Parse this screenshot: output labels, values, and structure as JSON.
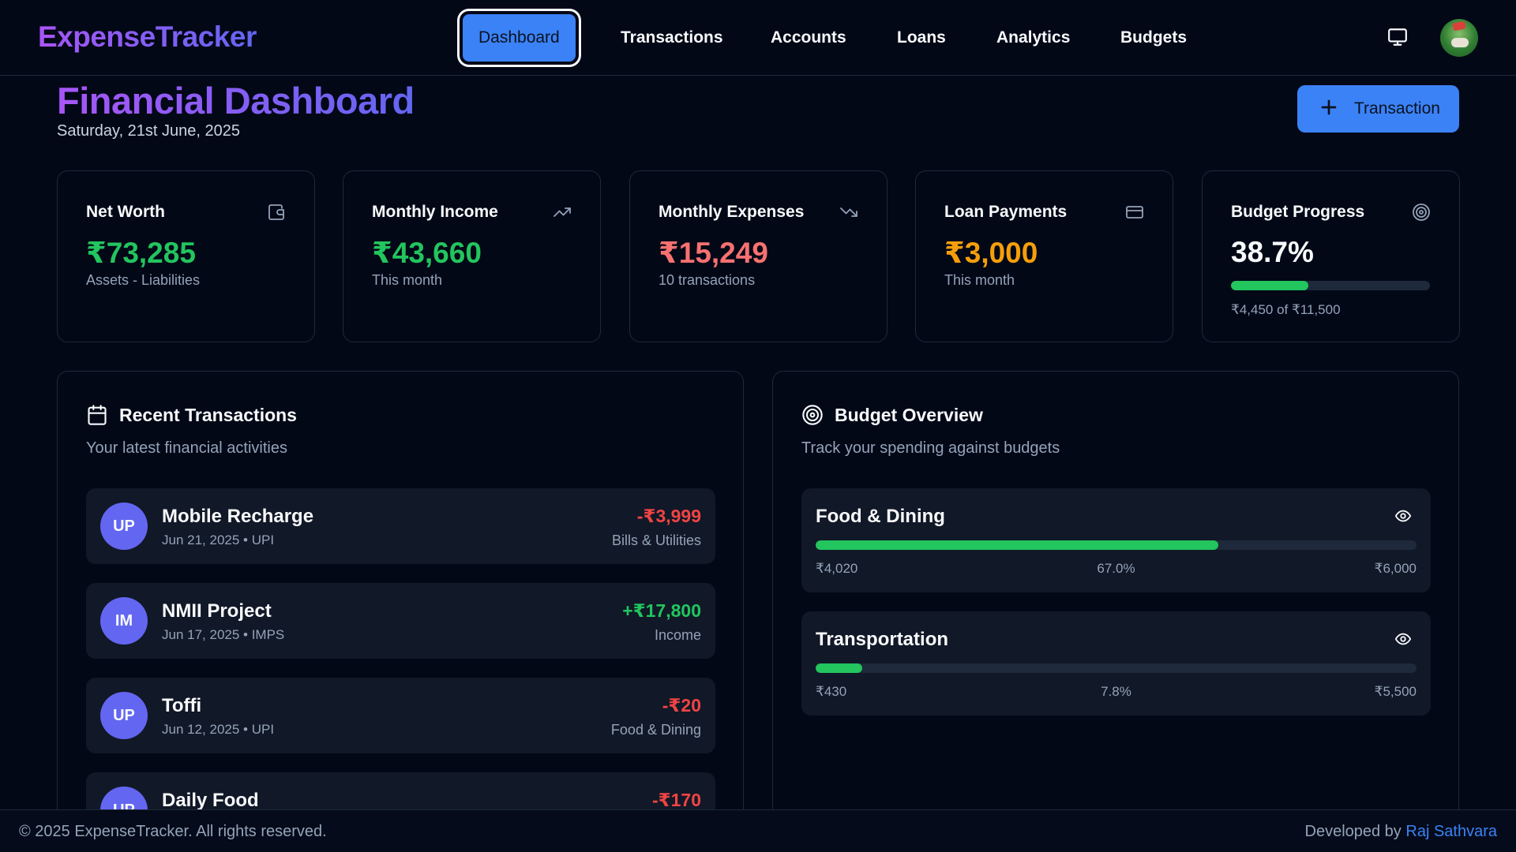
{
  "app": {
    "brand": "ExpenseTracker"
  },
  "nav": {
    "items": [
      "Dashboard",
      "Transactions",
      "Accounts",
      "Loans",
      "Analytics",
      "Budgets"
    ],
    "active": "Dashboard"
  },
  "header": {
    "title": "Financial Dashboard",
    "date": "Saturday, 21st June, 2025",
    "add_button_label": "Transaction"
  },
  "stats": {
    "net_worth": {
      "title": "Net Worth",
      "value": "₹73,285",
      "sub": "Assets - Liabilities",
      "icon": "wallet-icon"
    },
    "monthly_income": {
      "title": "Monthly Income",
      "value": "₹43,660",
      "sub": "This month",
      "icon": "trending-up-icon"
    },
    "monthly_expenses": {
      "title": "Monthly Expenses",
      "value": "₹15,249",
      "sub": "10 transactions",
      "icon": "trending-down-icon"
    },
    "loan_payments": {
      "title": "Loan Payments",
      "value": "₹3,000",
      "sub": "This month",
      "icon": "credit-card-icon"
    },
    "budget_progress": {
      "title": "Budget Progress",
      "value": "38.7%",
      "progress": 0.387,
      "sub": "₹4,450 of ₹11,500",
      "icon": "target-icon"
    }
  },
  "recent_transactions": {
    "title": "Recent Transactions",
    "subtitle": "Your latest financial activities",
    "items": [
      {
        "badge": "UP",
        "name": "Mobile Recharge",
        "meta": "Jun 21, 2025 • UPI",
        "amount": "-₹3,999",
        "category": "Bills & Utilities",
        "type": "expense"
      },
      {
        "badge": "IM",
        "name": "NMII Project",
        "meta": "Jun 17, 2025 • IMPS",
        "amount": "+₹17,800",
        "category": "Income",
        "type": "income"
      },
      {
        "badge": "UP",
        "name": "Toffi",
        "meta": "Jun 12, 2025 • UPI",
        "amount": "-₹20",
        "category": "Food & Dining",
        "type": "expense"
      },
      {
        "badge": "UP",
        "name": "Daily Food",
        "meta": "",
        "amount": "-₹170",
        "category": "",
        "type": "expense"
      }
    ]
  },
  "budget_overview": {
    "title": "Budget Overview",
    "subtitle": "Track your spending against budgets",
    "items": [
      {
        "name": "Food & Dining",
        "spent": "₹4,020",
        "percent": "67.0%",
        "progress": 0.67,
        "limit": "₹6,000"
      },
      {
        "name": "Transportation",
        "spent": "₹430",
        "percent": "7.8%",
        "progress": 0.078,
        "limit": "₹5,500"
      }
    ]
  },
  "footer": {
    "copyright": "© 2025 ExpenseTracker. All rights reserved.",
    "developed_by": "Developed by",
    "developer": "Raj Sathvara"
  },
  "colors": {
    "background": "#030817",
    "accent": "#3b82f6",
    "brand_gradient_start": "#a855f7",
    "brand_gradient_end": "#6366f1",
    "positive": "#22c55e",
    "negative": "#ef4444",
    "warning": "#f59e0b",
    "expense_value": "#f87171",
    "badge": "#6366f1"
  }
}
